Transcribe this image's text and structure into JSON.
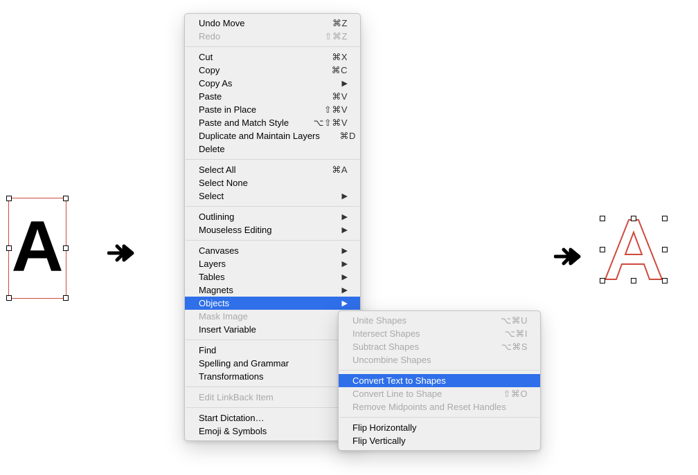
{
  "leftSelection": {
    "glyph": "A"
  },
  "menuPrimary": [
    {
      "type": "item",
      "label": "Undo Move",
      "shortcut": "⌘Z"
    },
    {
      "type": "item",
      "label": "Redo",
      "shortcut": "⇧⌘Z",
      "disabled": true
    },
    {
      "type": "sep"
    },
    {
      "type": "item",
      "label": "Cut",
      "shortcut": "⌘X"
    },
    {
      "type": "item",
      "label": "Copy",
      "shortcut": "⌘C"
    },
    {
      "type": "item",
      "label": "Copy As",
      "submenu": true
    },
    {
      "type": "item",
      "label": "Paste",
      "shortcut": "⌘V"
    },
    {
      "type": "item",
      "label": "Paste in Place",
      "shortcut": "⇧⌘V"
    },
    {
      "type": "item",
      "label": "Paste and Match Style",
      "shortcut": "⌥⇧⌘V"
    },
    {
      "type": "item",
      "label": "Duplicate and Maintain Layers",
      "shortcut": "⌘D"
    },
    {
      "type": "item",
      "label": "Delete"
    },
    {
      "type": "sep"
    },
    {
      "type": "item",
      "label": "Select All",
      "shortcut": "⌘A"
    },
    {
      "type": "item",
      "label": "Select None"
    },
    {
      "type": "item",
      "label": "Select",
      "submenu": true
    },
    {
      "type": "sep"
    },
    {
      "type": "item",
      "label": "Outlining",
      "submenu": true
    },
    {
      "type": "item",
      "label": "Mouseless Editing",
      "submenu": true
    },
    {
      "type": "sep"
    },
    {
      "type": "item",
      "label": "Canvases",
      "submenu": true
    },
    {
      "type": "item",
      "label": "Layers",
      "submenu": true
    },
    {
      "type": "item",
      "label": "Tables",
      "submenu": true
    },
    {
      "type": "item",
      "label": "Magnets",
      "submenu": true
    },
    {
      "type": "item",
      "label": "Objects",
      "submenu": true,
      "highlighted": true
    },
    {
      "type": "item",
      "label": "Mask Image",
      "disabled": true
    },
    {
      "type": "item",
      "label": "Insert Variable"
    },
    {
      "type": "sep"
    },
    {
      "type": "item",
      "label": "Find"
    },
    {
      "type": "item",
      "label": "Spelling and Grammar"
    },
    {
      "type": "item",
      "label": "Transformations"
    },
    {
      "type": "sep"
    },
    {
      "type": "item",
      "label": "Edit LinkBack Item",
      "disabled": true
    },
    {
      "type": "sep"
    },
    {
      "type": "item",
      "label": "Start Dictation…"
    },
    {
      "type": "item",
      "label": "Emoji & Symbols"
    }
  ],
  "menuSecondary": [
    {
      "type": "item",
      "label": "Unite Shapes",
      "shortcut": "⌥⌘U",
      "disabled": true
    },
    {
      "type": "item",
      "label": "Intersect Shapes",
      "shortcut": "⌥⌘I",
      "disabled": true
    },
    {
      "type": "item",
      "label": "Subtract Shapes",
      "shortcut": "⌥⌘S",
      "disabled": true
    },
    {
      "type": "item",
      "label": "Uncombine Shapes",
      "disabled": true
    },
    {
      "type": "sep"
    },
    {
      "type": "item",
      "label": "Convert Text to Shapes",
      "highlighted": true
    },
    {
      "type": "item",
      "label": "Convert Line to Shape",
      "shortcut": "⇧⌘O",
      "disabled": true
    },
    {
      "type": "item",
      "label": "Remove Midpoints and Reset Handles",
      "disabled": true
    },
    {
      "type": "sep"
    },
    {
      "type": "item",
      "label": "Flip Horizontally"
    },
    {
      "type": "item",
      "label": "Flip Vertically"
    }
  ],
  "colors": {
    "menuHighlight": "#2f6fe9",
    "selectionStroke": "#cf4a3e"
  }
}
